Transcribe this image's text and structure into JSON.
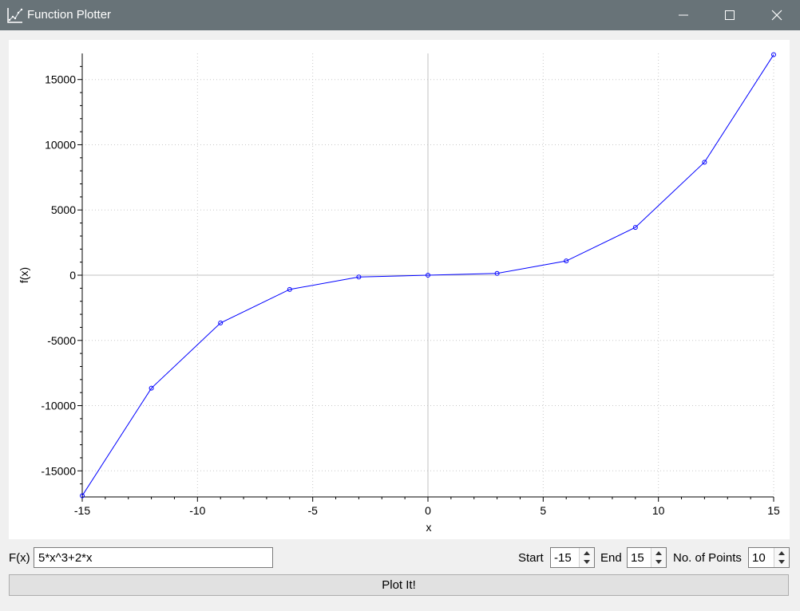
{
  "window": {
    "title": "Function Plotter",
    "app_icon": "chart-icon",
    "controls": [
      "minimize-icon",
      "maximize-icon",
      "close-icon"
    ]
  },
  "colors": {
    "titlebar": "#687378",
    "series": "#0000ff",
    "grid": "#c8c8c8",
    "zero_line": "#c0c0c0"
  },
  "chart_data": {
    "type": "line",
    "xlabel": "x",
    "ylabel": "f(x)",
    "xlim": [
      -15,
      15
    ],
    "ylim": [
      -17000,
      17000
    ],
    "x_ticks": [
      -15,
      -10,
      -5,
      0,
      5,
      10,
      15
    ],
    "y_ticks": [
      -15000,
      -10000,
      -5000,
      0,
      5000,
      10000,
      15000
    ],
    "grid": true,
    "markers": "circle",
    "series": [
      {
        "x": [
          -15,
          -12,
          -9,
          -6,
          -3,
          0,
          3,
          6,
          9,
          12,
          15
        ],
        "y": [
          -16905,
          -8664,
          -3663,
          -1092,
          -141,
          0,
          141,
          1092,
          3663,
          8664,
          16905
        ]
      }
    ]
  },
  "controls": {
    "fx_label": "F(x)",
    "fx_value": "5*x^3+2*x",
    "start_label": "Start",
    "start_value": "-15",
    "end_label": "End",
    "end_value": "15",
    "points_label": "No. of Points",
    "points_value": "10",
    "plot_button": "Plot It!"
  }
}
